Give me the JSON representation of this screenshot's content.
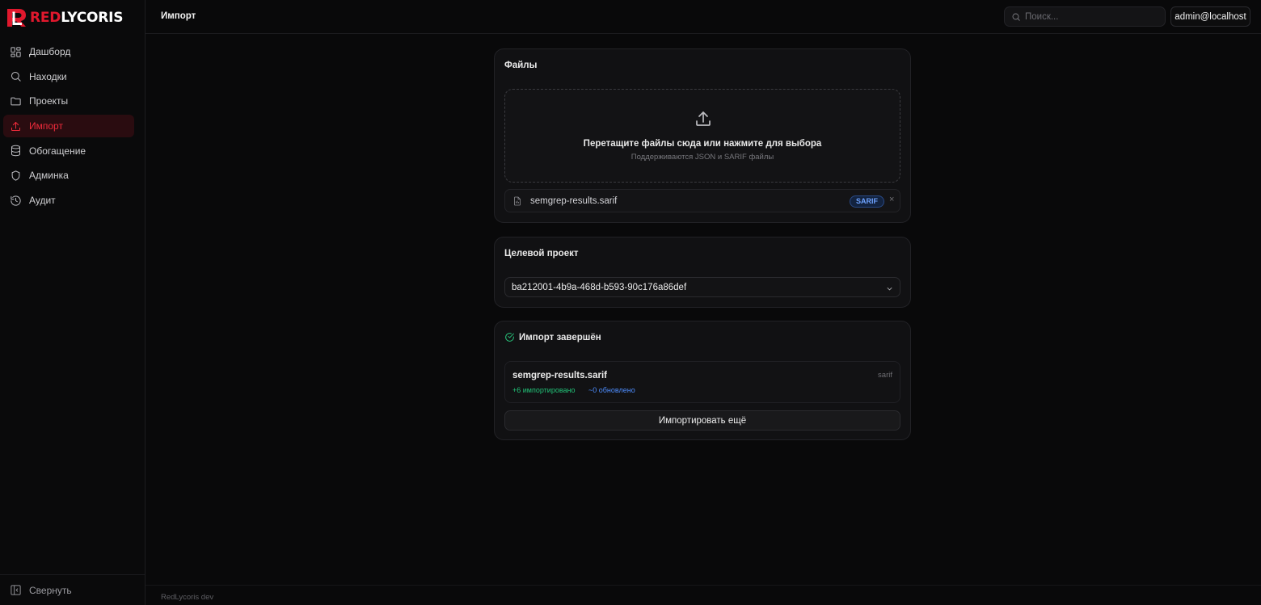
{
  "app": {
    "logo_red": "RED",
    "logo_white": "LYCORIS",
    "page_title": "Импорт",
    "footer": "RedLycoris dev"
  },
  "colors": {
    "accent": "#ef2b3b",
    "active_bg": "#2a0c10",
    "success": "#22c378",
    "info": "#4d8dff",
    "background": "#09090a",
    "card": "#111113"
  },
  "sidebar": {
    "items": [
      {
        "label": "Дашборд",
        "icon": "dashboard-icon",
        "active": false
      },
      {
        "label": "Находки",
        "icon": "search-icon",
        "active": false
      },
      {
        "label": "Проекты",
        "icon": "folder-icon",
        "active": false
      },
      {
        "label": "Импорт",
        "icon": "upload-icon",
        "active": true
      },
      {
        "label": "Обогащение",
        "icon": "database-icon",
        "active": false
      },
      {
        "label": "Админка",
        "icon": "shield-icon",
        "active": false
      },
      {
        "label": "Аудит",
        "icon": "history-icon",
        "active": false
      }
    ],
    "collapse_label": "Свернуть"
  },
  "header": {
    "search_placeholder": "Поиск...",
    "user": "admin@localhost"
  },
  "files_card": {
    "title": "Файлы",
    "drop_text": "Перетащите файлы сюда или нажмите для выбора",
    "drop_hint": "Поддерживаются JSON и SARIF файлы",
    "file_name": "semgrep-results.sarif",
    "file_badge": "SARIF",
    "remove_symbol": "×"
  },
  "target_card": {
    "title": "Целевой проект",
    "selected_value": "ba212001-4b9a-468d-b593-90c176a86def"
  },
  "result_card": {
    "title": "Импорт завершён",
    "file_name": "semgrep-results.sarif",
    "file_type": "sarif",
    "imported": "+6 импортировано",
    "updated": "~0 обновлено",
    "more_button": "Импортировать ещё"
  }
}
